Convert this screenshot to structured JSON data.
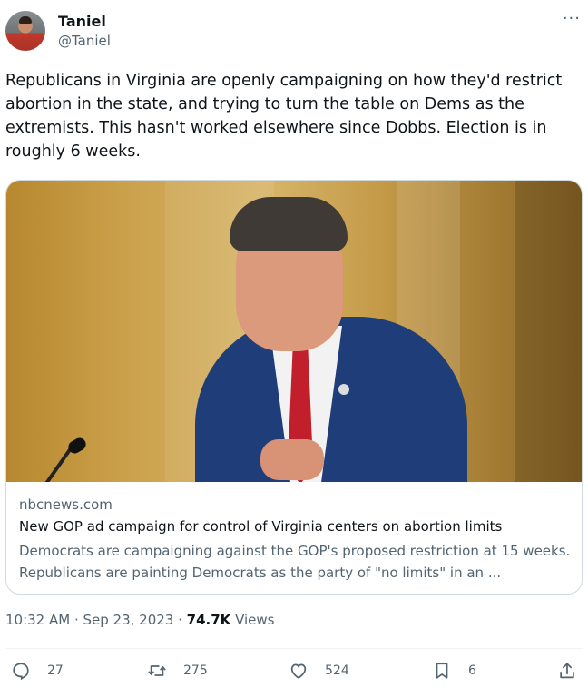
{
  "author": {
    "name": "Taniel",
    "handle": "@Taniel"
  },
  "tweet": {
    "text": "Republicans in Virginia are openly campaigning on how they'd restrict abortion in the state, and trying to turn the table on Dems as the extremists. This hasn't worked elsewhere since Dobbs.  Election is in roughly 6 weeks."
  },
  "card": {
    "image_icon": "politician-speaking-photo",
    "domain": "nbcnews.com",
    "title": "New GOP ad campaign for control of Virginia centers on abortion limits",
    "description": "Democrats are campaigning against the GOP's proposed restriction at 15 weeks. Republicans are painting Democrats as the party of \"no limits\" in an ..."
  },
  "meta": {
    "time": "10:32 AM · Sep 23, 2023 · ",
    "views_count": "74.7K",
    "views_label": " Views"
  },
  "actions": {
    "replies": "27",
    "reposts": "275",
    "likes": "524",
    "bookmarks": "6"
  },
  "icons": {
    "more": "more-icon",
    "reply": "reply-icon",
    "repost": "repost-icon",
    "like": "heart-icon",
    "bookmark": "bookmark-icon",
    "share": "share-icon"
  },
  "colors": {
    "text": "#0f1419",
    "secondary": "#536471",
    "border": "#cfd9de"
  }
}
